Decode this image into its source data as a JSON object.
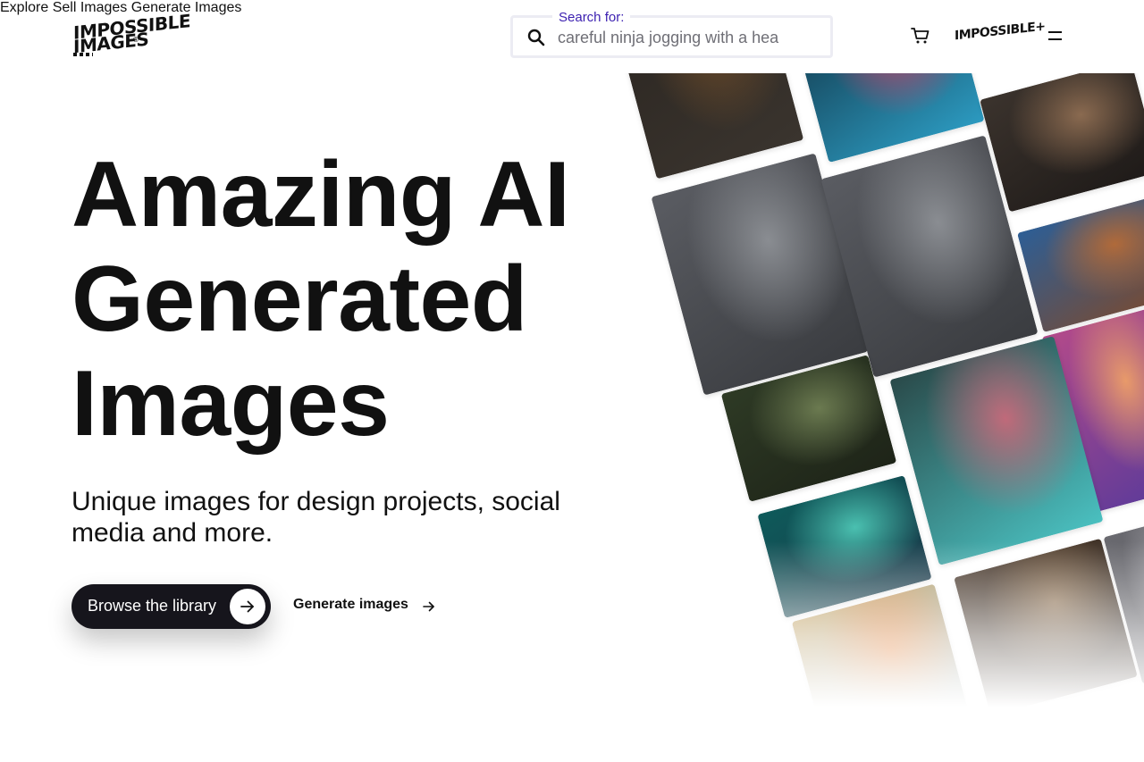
{
  "header": {
    "logo": {
      "line1": "IMPOSSIBLE",
      "line2": "IMAGES",
      "reg": "®"
    },
    "nav": [
      {
        "label": "Explore"
      },
      {
        "label": "Sell Images"
      },
      {
        "label": "Generate Images"
      }
    ],
    "search": {
      "label": "Search for:",
      "placeholder": "careful ninja jogging with a hea",
      "icon": "search-icon"
    },
    "cart_icon": "cart-icon",
    "plus_logo": "IMPOSSIBLE+",
    "menu_icon": "hamburger-menu-icon"
  },
  "hero": {
    "title_lines": [
      "Amazing AI",
      "Generated",
      "Images"
    ],
    "subtitle": "Unique images for design projects, social media and more.",
    "primary_cta": {
      "label": "Browse the library",
      "icon": "arrow-right-icon"
    },
    "secondary_cta": {
      "label": "Generate images",
      "icon": "arrow-right-icon"
    }
  },
  "collage": {
    "images": [
      {
        "name": "dark-room-figure-image",
        "colors": [
          "#2a2520",
          "#6a4a2a",
          "#3a342e"
        ]
      },
      {
        "name": "rainbow-light-puddle-image",
        "colors": [
          "#0e2a3a",
          "#d2436a",
          "#2c9ac0"
        ]
      },
      {
        "name": "butterfly-closeup-image",
        "colors": [
          "#3b332d",
          "#8a6a50",
          "#1e1a18"
        ]
      },
      {
        "name": "rain-woman-arms-raised-image-1",
        "colors": [
          "#5a5c62",
          "#8a8d92",
          "#3a3c40"
        ]
      },
      {
        "name": "rain-woman-arms-raised-image-2",
        "colors": [
          "#5a5c62",
          "#8a8d92",
          "#3a3c40"
        ]
      },
      {
        "name": "canyon-landscape-image",
        "colors": [
          "#2d5e95",
          "#b06a3a",
          "#7a4a30"
        ]
      },
      {
        "name": "abstract-colorful-light-image",
        "colors": [
          "#b34a8a",
          "#e89a6a",
          "#5a3a9a"
        ]
      },
      {
        "name": "greenhouse-figure-image",
        "colors": [
          "#2e3a25",
          "#6b7a50",
          "#1e2418"
        ]
      },
      {
        "name": "neon-couple-image",
        "colors": [
          "#2a4a4a",
          "#c06a7a",
          "#4ac0c0"
        ]
      },
      {
        "name": "aurora-sea-image",
        "colors": [
          "#0e5a5a",
          "#4ac0b0",
          "#1a3a4a"
        ]
      },
      {
        "name": "statue-face-image",
        "colors": [
          "#4a3a2e",
          "#8a6e50",
          "#2a2018"
        ]
      },
      {
        "name": "jar-hot-air-balloon-image",
        "colors": [
          "#c0a060",
          "#e07a30",
          "#8aa0a8"
        ]
      },
      {
        "name": "extra-tile-image",
        "colors": [
          "#6a6a70",
          "#9a9aa0",
          "#4a4a50"
        ]
      }
    ]
  }
}
